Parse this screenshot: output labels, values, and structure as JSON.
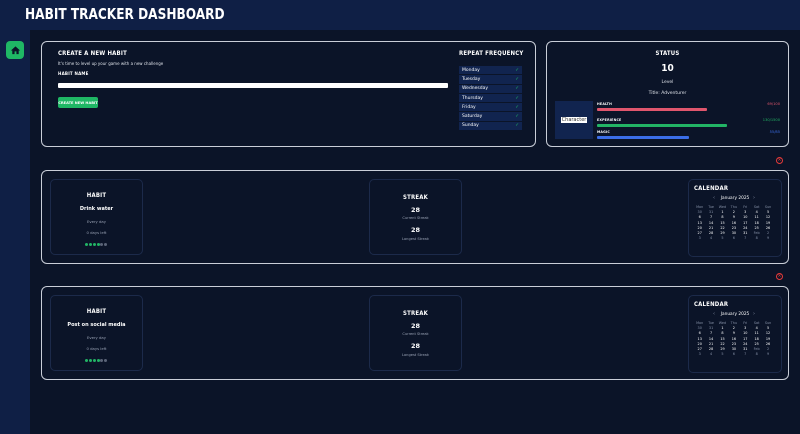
{
  "header": {
    "title": "HABIT TRACKER DASHBOARD"
  },
  "sidebar": {
    "home_icon": "home-icon"
  },
  "create": {
    "title": "CREATE A NEW HABIT",
    "subtitle": "It's time to level up your game with a new challenge",
    "name_label": "HABIT NAME",
    "name_value": "",
    "button": "CREATE NEW HABIT"
  },
  "repeat": {
    "title": "REPEAT FREQUENCY",
    "days": [
      "Monday",
      "Tuesday",
      "Wednesday",
      "Thursday",
      "Friday",
      "Saturday",
      "Sunday"
    ],
    "check": "✓"
  },
  "status": {
    "title": "STATUS",
    "level": "10",
    "level_label": "Level",
    "title_line": "Title: Adventurer",
    "image_alt": "Character",
    "stats": [
      {
        "label": "HEALTH",
        "value": "69/100",
        "fraction": 0.69,
        "color": "#e0566d"
      },
      {
        "label": "EXPERIENCE",
        "value": "130/1500",
        "fraction": 0.7,
        "color": "#22b465"
      },
      {
        "label": "MAGIC",
        "value": "55/85",
        "fraction": 0.5,
        "color": "#3b6ee8"
      }
    ]
  },
  "habits": [
    {
      "habit_title": "HABIT",
      "name": "Drink water",
      "freq": "Every day",
      "days_left": "0 days left",
      "dots_filled": 4,
      "dots_total": 6,
      "streak_title": "STREAK",
      "current": "28",
      "current_label": "Current Streak",
      "longest": "28",
      "longest_label": "Longest Streak",
      "calendar_title": "CALENDAR",
      "month": "January 2025",
      "delete": "×"
    },
    {
      "habit_title": "HABIT",
      "name": "Post on social media",
      "freq": "Every day",
      "days_left": "0 days left",
      "dots_filled": 4,
      "dots_total": 6,
      "streak_title": "STREAK",
      "current": "28",
      "current_label": "Current Streak",
      "longest": "28",
      "longest_label": "Longest Streak",
      "calendar_title": "CALENDAR",
      "month": "January 2025",
      "delete": "×"
    }
  ],
  "calendar": {
    "prev": "‹",
    "next": "›",
    "weekdays": [
      "Mon",
      "Tue",
      "Wed",
      "Thu",
      "Fri",
      "Sat",
      "Sun"
    ],
    "days": [
      "30",
      "31",
      "1",
      "2",
      "3",
      "4",
      "5",
      "6",
      "7",
      "8",
      "9",
      "10",
      "11",
      "12",
      "13",
      "14",
      "15",
      "16",
      "17",
      "18",
      "19",
      "20",
      "21",
      "22",
      "23",
      "24",
      "25",
      "26",
      "27",
      "28",
      "29",
      "30",
      "31",
      "Feb",
      "2",
      "3",
      "4",
      "5",
      "6",
      "7",
      "8",
      "9"
    ]
  }
}
